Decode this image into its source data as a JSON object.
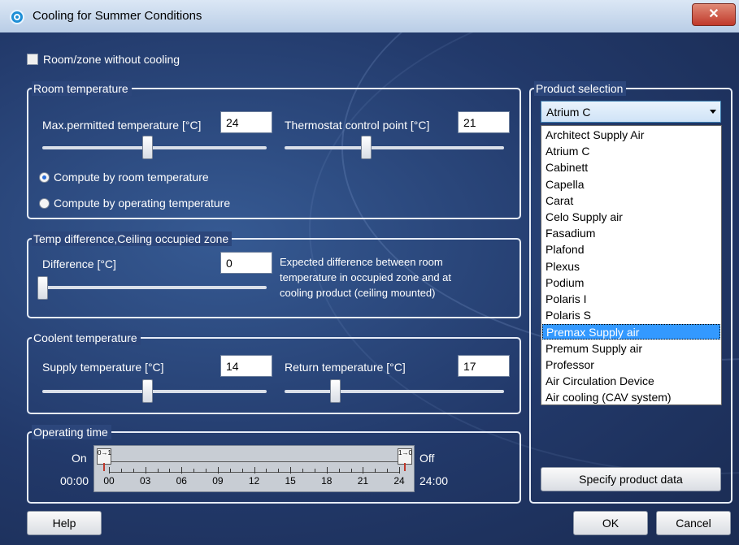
{
  "window": {
    "title": "Cooling for Summer Conditions",
    "close_glyph": "✕"
  },
  "no_cooling": {
    "label": "Room/zone without cooling",
    "checked": false
  },
  "room_temperature": {
    "title": "Room temperature",
    "max_label": "Max.permitted temperature [°C]",
    "max_value": "24",
    "max_slider_position": 0.45,
    "thermostat_label": "Thermostat control point [°C]",
    "thermostat_value": "21",
    "thermostat_slider_position": 0.38,
    "radio_room": "Compute by room temperature",
    "radio_operating": "Compute by operating temperature",
    "selected": "room"
  },
  "temp_difference": {
    "title": "Temp difference,Ceiling occupied zone",
    "label": "Difference [°C]",
    "value": "0",
    "slider_position": 0.0,
    "description": "Expected difference between room temperature in occupied zone and at cooling product (ceiling mounted)",
    "description_lines": [
      "Expected difference between room",
      "temperature in occupied zone and at",
      "cooling product (ceiling mounted)"
    ]
  },
  "coolent_temperature": {
    "title": "Coolent temperature",
    "supply_label": "Supply temperature [°C]",
    "supply_value": "14",
    "supply_slider_position": 0.45,
    "return_label": "Return temperature [°C]",
    "return_value": "17",
    "return_slider_position": 0.22
  },
  "operating_time": {
    "title": "Operating time",
    "on_label": "On",
    "off_label": "Off",
    "start_label": "00:00",
    "end_label": "24:00",
    "start_marker": "0→1",
    "end_marker": "1→0",
    "ticks": [
      "00",
      "03",
      "06",
      "09",
      "12",
      "15",
      "18",
      "21",
      "24"
    ]
  },
  "product_selection": {
    "title": "Product selection",
    "selected": "Atrium C",
    "options": [
      "Architect Supply Air",
      "Atrium C",
      "Cabinett",
      "Capella",
      "Carat",
      "Celo Supply air",
      "Fasadium",
      "Plafond",
      "Plexus",
      "Podium",
      "Polaris I",
      "Polaris S",
      "Premax Supply air",
      "Premum Supply air",
      "Professor",
      "Air Circulation Device",
      "Air cooling (CAV system)"
    ],
    "highlighted": "Premax Supply air",
    "specify_button": "Specify product data"
  },
  "buttons": {
    "help": "Help",
    "ok": "OK",
    "cancel": "Cancel"
  }
}
